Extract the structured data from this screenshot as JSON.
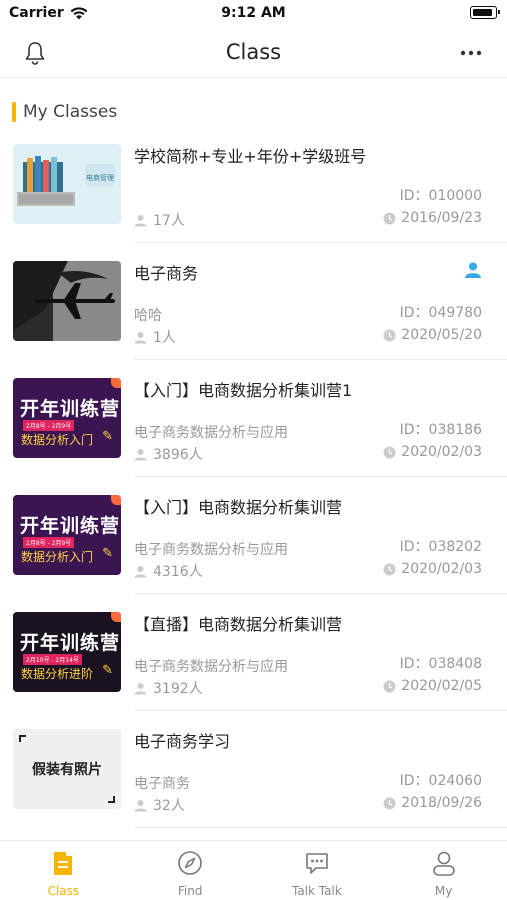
{
  "status_bar": {
    "carrier": "Carrier",
    "time": "9:12 AM"
  },
  "nav": {
    "title": "Class",
    "left_icon": "bell-icon",
    "right_icon": "more-icon"
  },
  "section": {
    "title": "My Classes",
    "accent_color": "#f7b500"
  },
  "classes": [
    {
      "title": "学校简称+专业+年份+学级班号",
      "subtitle": "",
      "id_text": "ID：010000",
      "count": "17人",
      "date": "2016/09/23",
      "thumb_text": "电商管理"
    },
    {
      "title": "电子商务",
      "subtitle": "哈哈",
      "id_text": "ID：049780",
      "count": "1人",
      "date": "2020/05/20",
      "badge_icon": "person-icon"
    },
    {
      "title": "【入门】电商数据分析集训营1",
      "subtitle": "电子商务数据分析与应用",
      "id_text": "ID：038186",
      "count": "3896人",
      "date": "2020/02/03",
      "thumb_big": "开年训练营",
      "thumb_dates": "2月8号 - 2月9号",
      "thumb_sub": "数据分析入门"
    },
    {
      "title": "【入门】电商数据分析集训营",
      "subtitle": "电子商务数据分析与应用",
      "id_text": "ID：038202",
      "count": "4316人",
      "date": "2020/02/03",
      "thumb_big": "开年训练营",
      "thumb_dates": "2月8号 - 2月9号",
      "thumb_sub": "数据分析入门"
    },
    {
      "title": "【直播】电商数据分析集训营",
      "subtitle": "电子商务数据分析与应用",
      "id_text": "ID：038408",
      "count": "3192人",
      "date": "2020/02/05",
      "thumb_big": "开年训练营",
      "thumb_dates": "2月10号 - 2月14号",
      "thumb_sub": "数据分析进阶"
    },
    {
      "title": "电子商务学习",
      "subtitle": "电子商务",
      "id_text": "ID：024060",
      "count": "32人",
      "date": "2018/09/26",
      "thumb_text": "假装有照片"
    }
  ],
  "tabs": [
    {
      "label": "Class",
      "icon": "class-icon",
      "active": true
    },
    {
      "label": "Find",
      "icon": "compass-icon",
      "active": false
    },
    {
      "label": "Talk Talk",
      "icon": "chat-icon",
      "active": false
    },
    {
      "label": "My",
      "icon": "profile-icon",
      "active": false
    }
  ],
  "colors": {
    "accent": "#f7b500",
    "text_muted": "#999999",
    "badge_blue": "#37a8e8"
  }
}
